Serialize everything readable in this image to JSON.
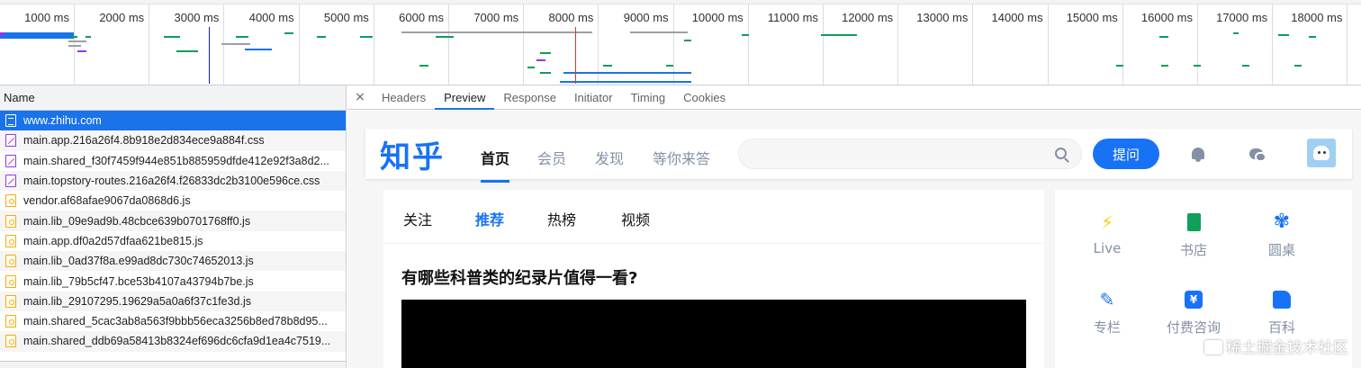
{
  "timeline": {
    "tick_labels": [
      "1000 ms",
      "2000 ms",
      "3000 ms",
      "4000 ms",
      "5000 ms",
      "6000 ms",
      "7000 ms",
      "8000 ms",
      "9000 ms",
      "10000 ms",
      "11000 ms",
      "12000 ms",
      "13000 ms",
      "14000 ms",
      "15000 ms",
      "16000 ms",
      "17000 ms",
      "18000 ms"
    ],
    "colors": {
      "dom_content_loaded": "#1a1aa6",
      "load": "#e8331f",
      "waiting": "#0f9d58",
      "download": "#1a73e8",
      "stalled": "#9aa0a6"
    }
  },
  "requests": {
    "column_header": "Name",
    "rows": [
      {
        "name": "www.zhihu.com",
        "type": "doc",
        "selected": true
      },
      {
        "name": "main.app.216a26f4.8b918e2d834ece9a884f.css",
        "type": "css"
      },
      {
        "name": "main.shared_f30f7459f944e851b885959dfde412e92f3a8d2...",
        "type": "css"
      },
      {
        "name": "main.topstory-routes.216a26f4.f26833dc2b3100e596ce.css",
        "type": "css"
      },
      {
        "name": "vendor.af68afae9067da0868d6.js",
        "type": "js"
      },
      {
        "name": "main.lib_09e9ad9b.48cbce639b0701768ff0.js",
        "type": "js"
      },
      {
        "name": "main.app.df0a2d57dfaa621be815.js",
        "type": "js"
      },
      {
        "name": "main.lib_0ad37f8a.e99ad8dc730c74652013.js",
        "type": "js"
      },
      {
        "name": "main.lib_79b5cf47.bce53b4107a43794b7be.js",
        "type": "js"
      },
      {
        "name": "main.lib_29107295.19629a5a0a6f37c1fe3d.js",
        "type": "js"
      },
      {
        "name": "main.shared_5cac3ab8a563f9bbb56eca3256b8ed78b8d95...",
        "type": "js"
      },
      {
        "name": "main.shared_ddb69a58413b8324ef696dc6cfa9d1ea4c7519...",
        "type": "js"
      }
    ]
  },
  "detail_tabs": {
    "close": "×",
    "items": [
      {
        "label": "Headers",
        "active": false
      },
      {
        "label": "Preview",
        "active": true
      },
      {
        "label": "Response",
        "active": false
      },
      {
        "label": "Initiator",
        "active": false
      },
      {
        "label": "Timing",
        "active": false
      },
      {
        "label": "Cookies",
        "active": false
      }
    ]
  },
  "preview": {
    "logo": "知乎",
    "nav": [
      "首页",
      "会员",
      "发现",
      "等你来答"
    ],
    "ask_button": "提问",
    "feed_tabs": [
      "关注",
      "推荐",
      "热榜",
      "视频"
    ],
    "question_title": "有哪些科普类的纪录片值得一看?",
    "side_items": [
      "Live",
      "书店",
      "圆桌",
      "专栏",
      "付费咨询",
      "百科"
    ],
    "brand_color": "#1772f6"
  },
  "watermark": "稀土掘金技术社区"
}
